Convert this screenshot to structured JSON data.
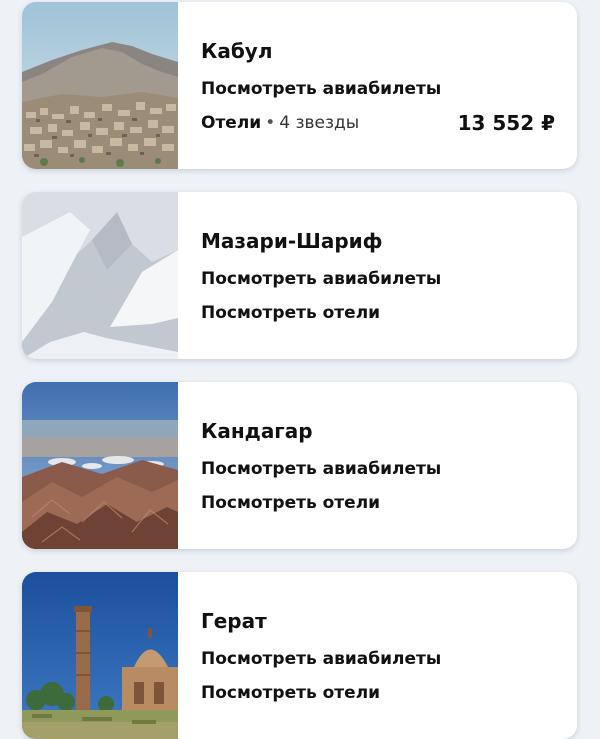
{
  "destinations": [
    {
      "city": "Кабул",
      "flights_link": "Посмотреть авиабилеты",
      "hotels_label": "Отели",
      "separator": "•",
      "hotels_rating": "4 звезды",
      "price": "13 552 ₽"
    },
    {
      "city": "Мазари-Шариф",
      "flights_link": "Посмотреть авиабилеты",
      "hotels_link": "Посмотреть отели"
    },
    {
      "city": "Кандагар",
      "flights_link": "Посмотреть авиабилеты",
      "hotels_link": "Посмотреть отели"
    },
    {
      "city": "Герат",
      "flights_link": "Посмотреть авиабилеты",
      "hotels_link": "Посмотреть отели"
    }
  ]
}
